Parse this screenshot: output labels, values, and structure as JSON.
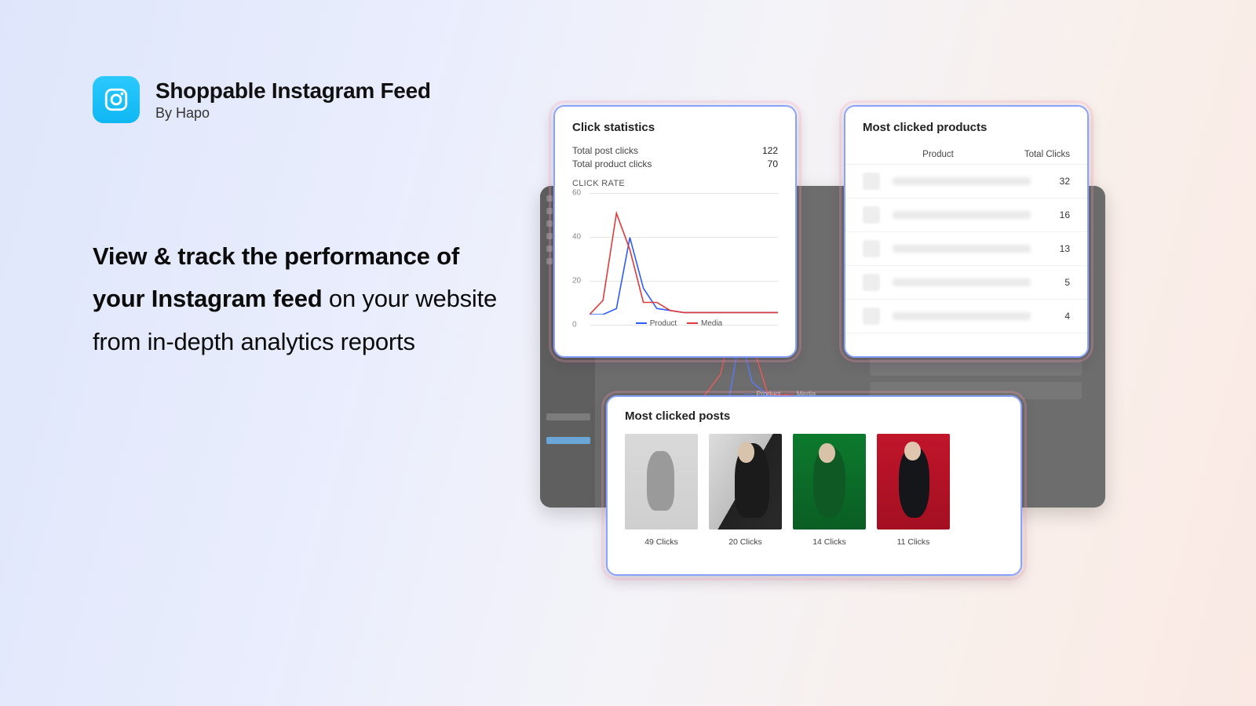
{
  "header": {
    "title": "Shoppable Instagram Feed",
    "byline": "By Hapo"
  },
  "tagline": {
    "strong": "View & track the performance of your Instagram feed",
    "rest": " on your website from in-depth analytics reports"
  },
  "stats_card": {
    "title": "Click statistics",
    "rows": [
      {
        "label": "Total post clicks",
        "value": "122"
      },
      {
        "label": "Total product clicks",
        "value": "70"
      }
    ],
    "rate_label": "CLICK RATE",
    "legend": {
      "a": "Product",
      "b": "Media"
    }
  },
  "products_card": {
    "title": "Most clicked products",
    "head": {
      "product": "Product",
      "clicks": "Total Clicks"
    },
    "rows": [
      {
        "value": "32"
      },
      {
        "value": "16"
      },
      {
        "value": "13"
      },
      {
        "value": "5"
      },
      {
        "value": "4"
      }
    ]
  },
  "posts_card": {
    "title": "Most clicked posts",
    "posts": [
      {
        "caption": "49 Clicks"
      },
      {
        "caption": "20 Clicks"
      },
      {
        "caption": "14 Clicks"
      },
      {
        "caption": "11 Clicks"
      }
    ]
  },
  "chart_data": {
    "type": "line",
    "title": "CLICK RATE",
    "ylabel": "",
    "ylim": [
      0,
      60
    ],
    "y_ticks": [
      0,
      20,
      40,
      60
    ],
    "x": [
      0,
      1,
      2,
      3,
      4,
      5,
      6,
      7,
      8,
      9,
      10,
      11,
      12,
      13,
      14
    ],
    "series": [
      {
        "name": "Product",
        "color": "#2b5bff",
        "values": [
          0,
          0,
          3,
          38,
          13,
          3,
          2,
          1,
          1,
          1,
          1,
          1,
          1,
          1,
          1
        ]
      },
      {
        "name": "Media",
        "color": "#e03a3a",
        "values": [
          0,
          7,
          50,
          32,
          6,
          6,
          2,
          1,
          1,
          1,
          1,
          1,
          1,
          1,
          1
        ]
      }
    ]
  }
}
